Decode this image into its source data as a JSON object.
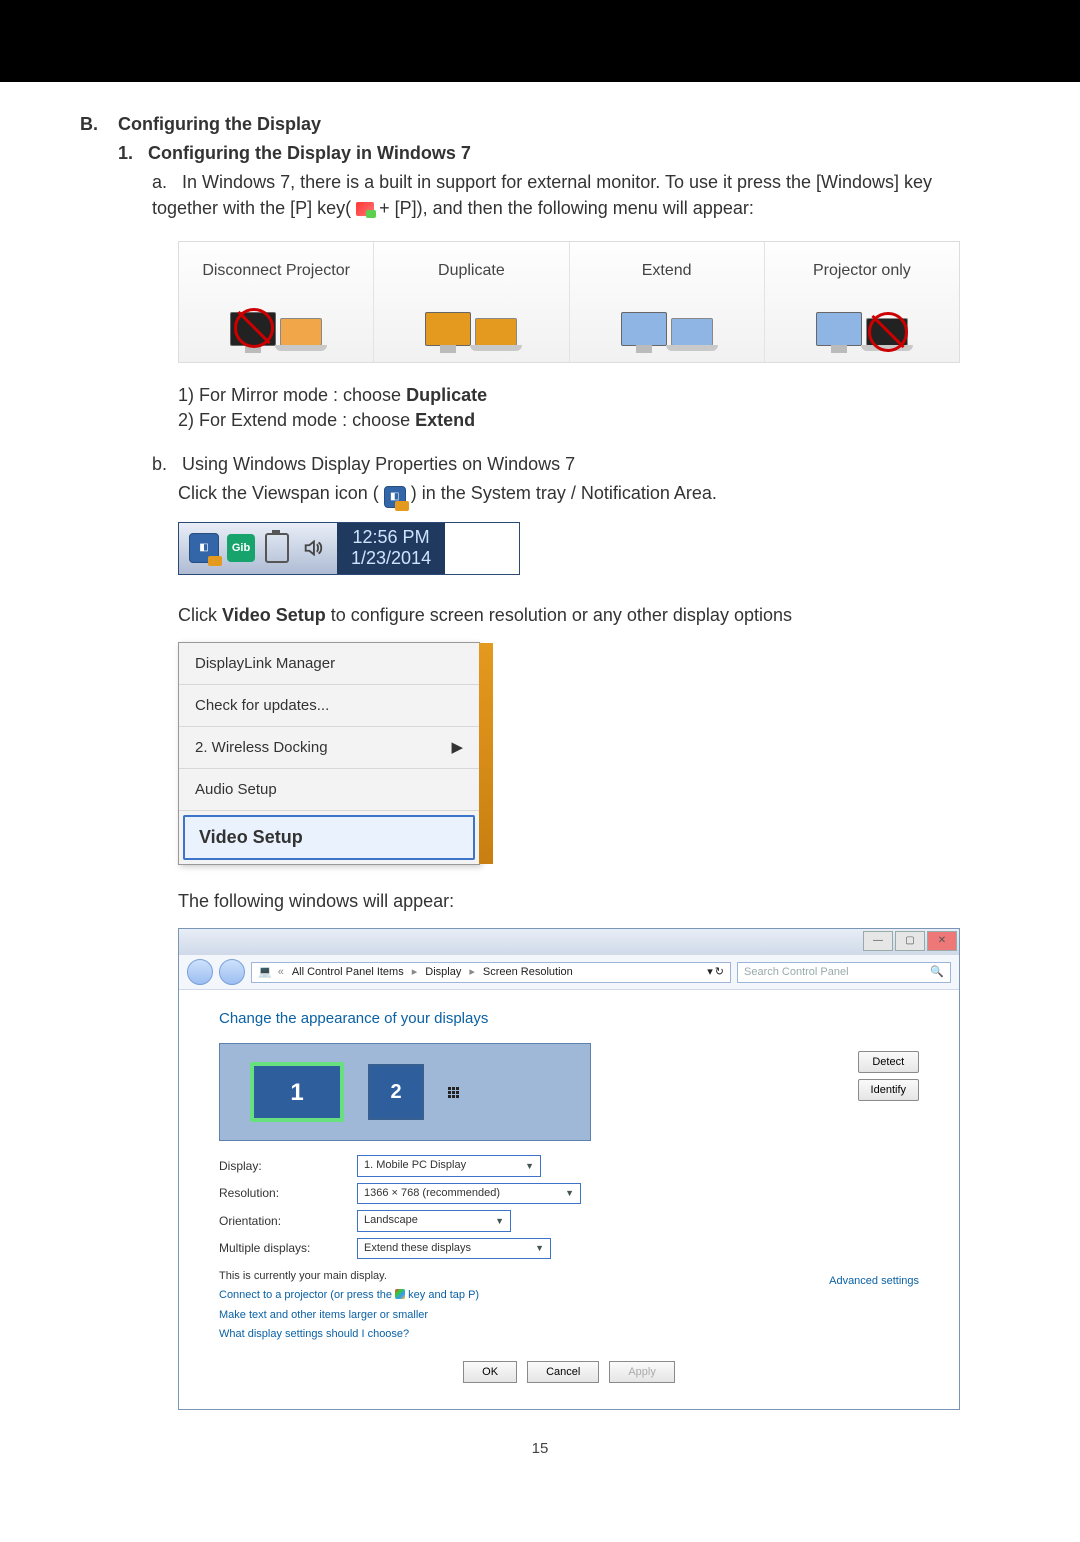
{
  "section": {
    "label_b": "B.",
    "title_b": "Configuring the Display",
    "label_1": "1.",
    "title_1": "Configuring the Display in Windows 7",
    "bullet_a": "a.",
    "para_a": "In Windows 7, there is a built in support for external monitor. To use it press the [Windows] key together with the [P] key( ",
    "para_a_key": " + [P]), and then the following menu will appear:",
    "step1_prefix": "1) For Mirror mode : choose",
    "step1_bold": "Duplicate",
    "step2_prefix": "2) For Extend mode : choose",
    "step2_bold": "Extend",
    "bullet_b": "b.",
    "para_b_line1": "Using Windows Display Properties on Windows 7",
    "para_b_line2_pre": "Click the Viewspan icon ( ",
    "para_b_line2_post": " ) in the System tray / Notification Area.",
    "click_video_pre": "Click",
    "click_video_bold": "Video Setup",
    "click_video_post": "to configure screen resolution or any other display options",
    "following_windows": "The following windows will appear:"
  },
  "proj": {
    "opts": [
      {
        "label": "Disconnect Projector"
      },
      {
        "label": "Duplicate"
      },
      {
        "label": "Extend"
      },
      {
        "label": "Projector only"
      }
    ]
  },
  "systray": {
    "time": "12:56 PM",
    "date": "1/23/2014",
    "gh": "Gib"
  },
  "ctx": {
    "items": [
      "DisplayLink Manager",
      "Check for updates...",
      "2. Wireless Docking",
      "Audio Setup",
      "Video Setup"
    ]
  },
  "cp": {
    "breadcrumb": {
      "p1": "All Control Panel Items",
      "p2": "Display",
      "p3": "Screen Resolution"
    },
    "search_placeholder": "Search Control Panel",
    "heading": "Change the appearance of your displays",
    "detect": "Detect",
    "identify": "Identify",
    "disp_label": "Display:",
    "disp_value": "1. Mobile PC Display",
    "res_label": "Resolution:",
    "res_value": "1366 × 768 (recommended)",
    "ori_label": "Orientation:",
    "ori_value": "Landscape",
    "multi_label": "Multiple displays:",
    "multi_value": "Extend these displays",
    "info": "This is currently your main display.",
    "adv": "Advanced settings",
    "link1_pre": "Connect to a projector (or press the ",
    "link1_post": " key and tap P)",
    "link2": "Make text and other items larger or smaller",
    "link3": "What display settings should I choose?",
    "ok": "OK",
    "cancel": "Cancel",
    "apply": "Apply",
    "num1": "1",
    "num2": "2"
  },
  "page_number": "15"
}
